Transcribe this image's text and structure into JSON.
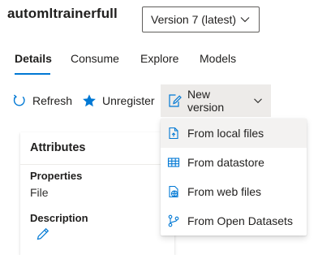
{
  "header": {
    "title": "automltrainerfull",
    "version_selected": "Version 7 (latest)"
  },
  "tabs": [
    {
      "label": "Details",
      "active": true
    },
    {
      "label": "Consume",
      "active": false
    },
    {
      "label": "Explore",
      "active": false
    },
    {
      "label": "Models",
      "active": false
    }
  ],
  "toolbar": {
    "refresh_label": "Refresh",
    "unregister_label": "Unregister",
    "new_version_label": "New version"
  },
  "new_version_menu": {
    "expanded": true,
    "items": [
      {
        "label": "From local files",
        "icon": "local-file-icon",
        "highlighted": true
      },
      {
        "label": "From datastore",
        "icon": "table-icon",
        "highlighted": false
      },
      {
        "label": "From web files",
        "icon": "web-file-icon",
        "highlighted": false
      },
      {
        "label": "From Open Datasets",
        "icon": "branch-icon",
        "highlighted": false
      }
    ]
  },
  "attributes_card": {
    "title": "Attributes",
    "properties_label": "Properties",
    "properties_value": "File",
    "description_label": "Description",
    "edit_icon": "pencil-icon"
  },
  "colors": {
    "accent": "#0078d4",
    "text": "#201f1e",
    "toolbar_active_bg": "#edebe9",
    "menu_hover_bg": "#f3f2f1"
  }
}
